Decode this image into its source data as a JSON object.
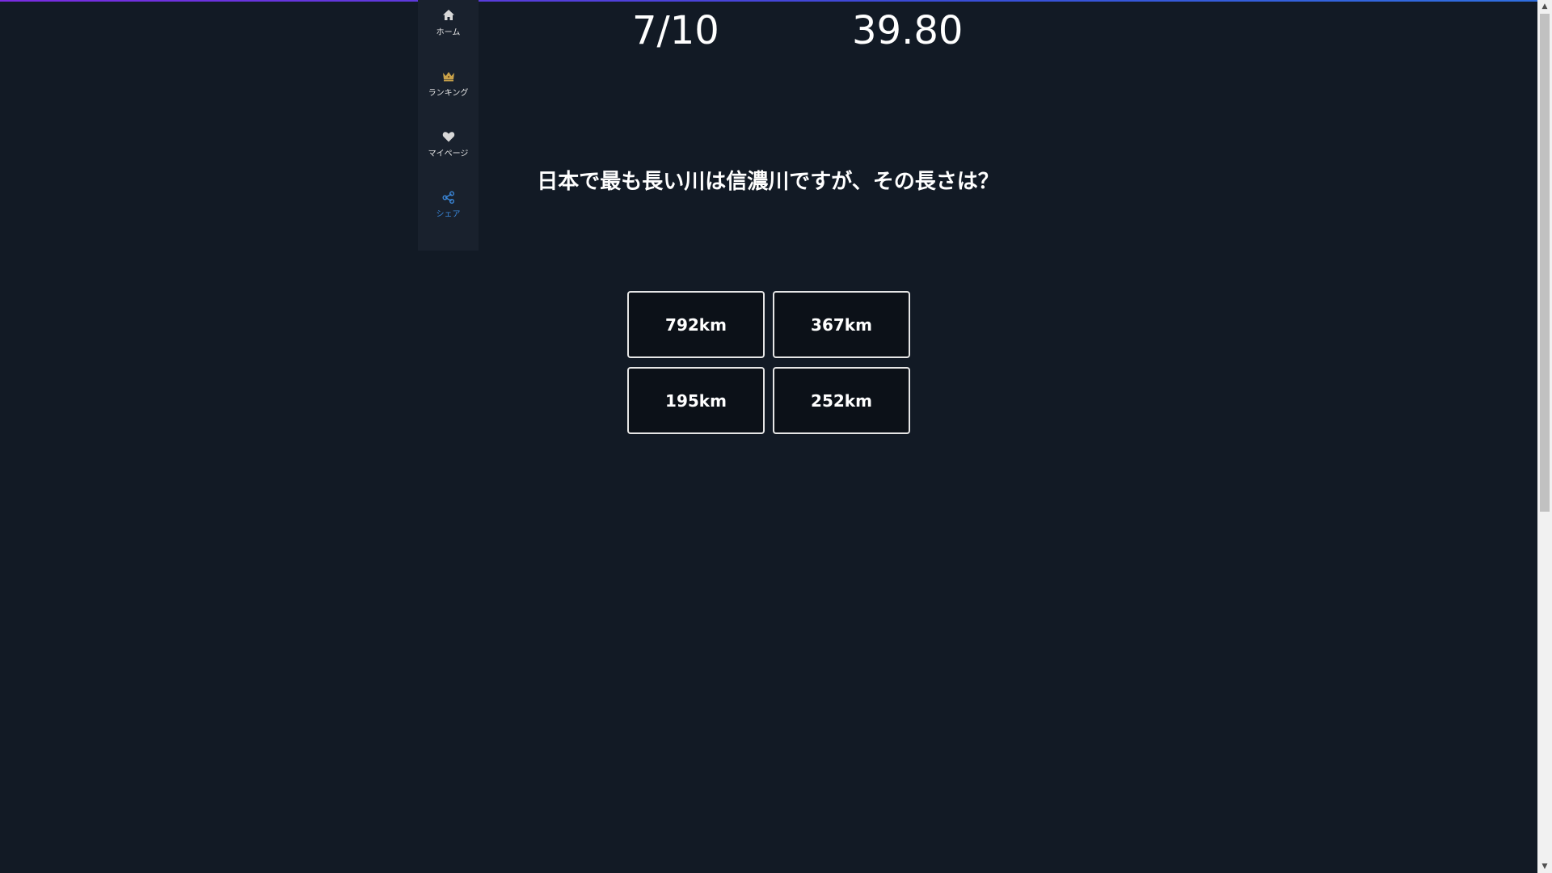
{
  "sidebar": {
    "items": [
      {
        "label": "ホーム",
        "icon": "home-icon"
      },
      {
        "label": "ランキング",
        "icon": "crown-icon"
      },
      {
        "label": "マイページ",
        "icon": "heart-icon"
      },
      {
        "label": "シェア",
        "icon": "share-icon"
      }
    ],
    "active_color": "#3a86d8",
    "crown_color": "#c9a24a"
  },
  "quiz": {
    "progress": "7/10",
    "timer": "39.80",
    "question": "日本で最も長い川は信濃川ですが、その長さは？",
    "answers": [
      "792km",
      "367km",
      "195km",
      "252km"
    ]
  },
  "colors": {
    "background": "#121a25",
    "sidebar": "#19212d",
    "answer_background": "#0c1118",
    "answer_border": "#e6e6e6"
  }
}
